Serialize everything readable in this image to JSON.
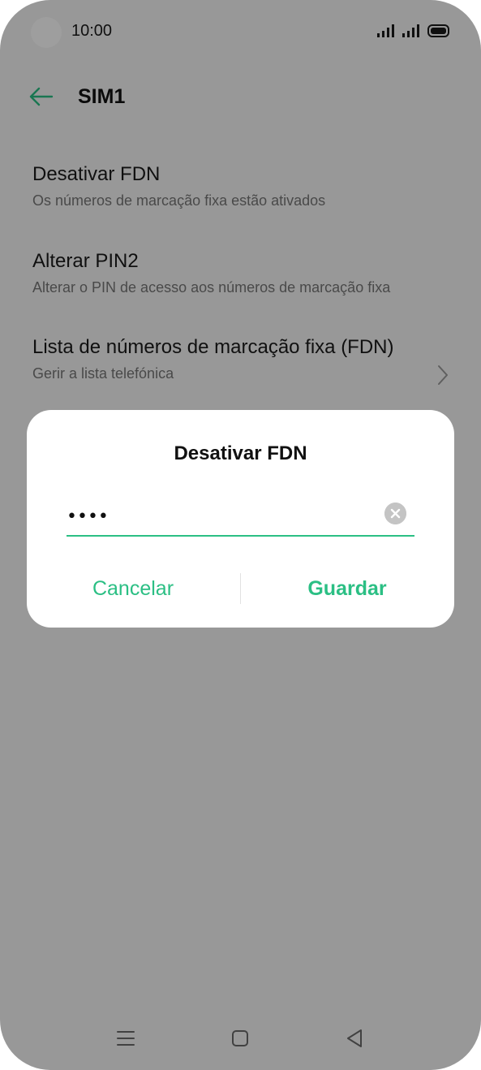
{
  "status_bar": {
    "time": "10:00",
    "icons": [
      "signal-icon",
      "signal-icon",
      "battery-icon"
    ]
  },
  "header": {
    "back_icon": "arrow-left-icon",
    "title": "SIM1"
  },
  "settings": {
    "items": [
      {
        "title": "Desativar FDN",
        "subtitle": "Os números de marcação fixa estão ativados"
      },
      {
        "title": "Alterar PIN2",
        "subtitle": "Alterar o PIN de acesso aos números de marcação fixa"
      },
      {
        "title": "Lista de números de marcação fixa (FDN)",
        "subtitle": "Gerir a lista telefónica",
        "icon": "chevron-right-icon"
      }
    ]
  },
  "dialog": {
    "title": "Desativar FDN",
    "input_value": "••••",
    "clear_icon": "clear-circle-icon",
    "cancel_label": "Cancelar",
    "save_label": "Guardar"
  },
  "nav_bar": {
    "icons": [
      "menu-icon",
      "home-icon",
      "back-triangle-icon"
    ]
  },
  "colors": {
    "accent": "#2bbf84",
    "scrim": "rgba(0,0,0,0.38)",
    "background": "#f6f6f6"
  }
}
